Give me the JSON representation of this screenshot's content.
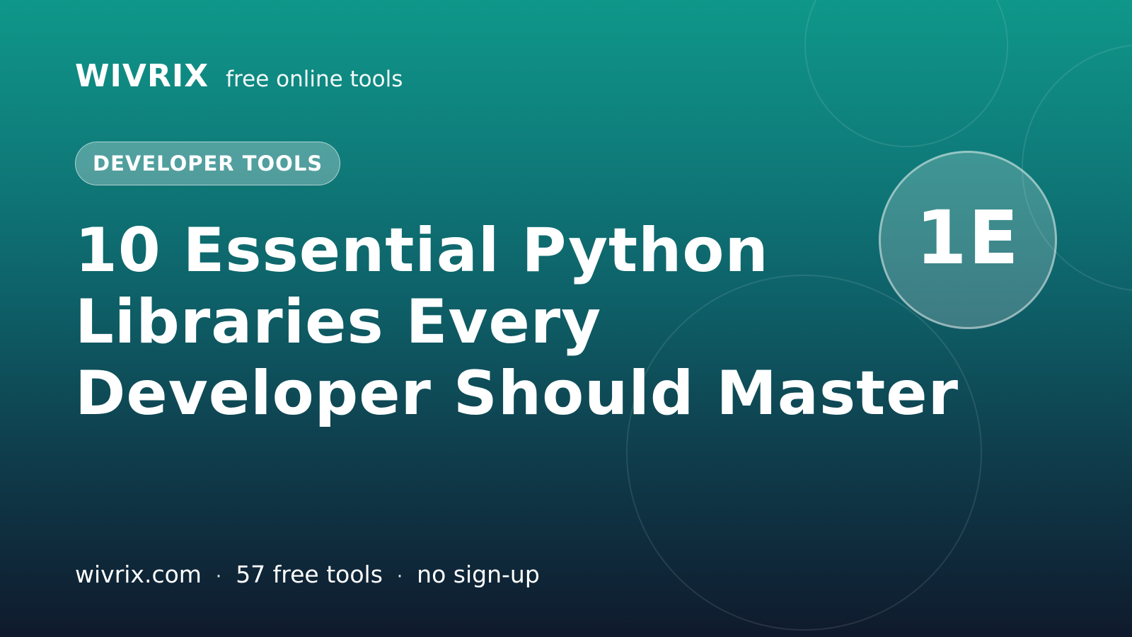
{
  "brand": {
    "name": "WIVRIX",
    "tagline": "free online tools"
  },
  "category": {
    "label": "DEVELOPER TOOLS"
  },
  "headline": {
    "lines": [
      "10 Essential Python",
      "Libraries Every",
      "Developer Should Master"
    ]
  },
  "badge": {
    "text": "1E"
  },
  "footer": {
    "site": "wivrix.com",
    "separator": "·",
    "tools_count": "57 free tools",
    "note": "no sign-up"
  },
  "colors": {
    "gradient_top": "#0f978a",
    "gradient_bottom": "#0f1a2c",
    "text": "#ffffff"
  }
}
